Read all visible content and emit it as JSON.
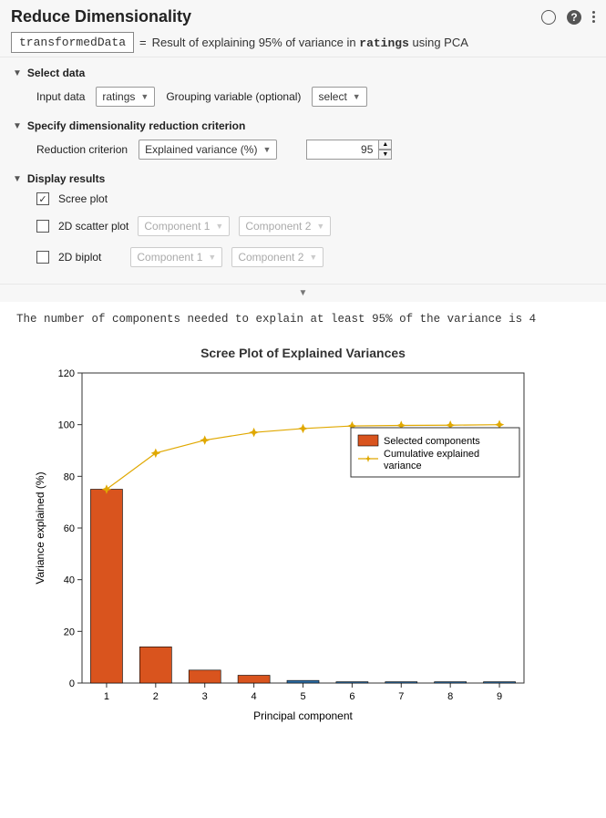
{
  "header": {
    "title": "Reduce Dimensionality",
    "var_name": "transformedData",
    "equals": "=",
    "result_text_pre": "Result of explaining 95% of variance in ",
    "result_text_mono": "ratings",
    "result_text_post": " using PCA"
  },
  "sections": {
    "select_data": {
      "title": "Select data",
      "input_label": "Input data",
      "input_value": "ratings",
      "grouping_label": "Grouping variable (optional)",
      "grouping_value": "select"
    },
    "criterion": {
      "title": "Specify dimensionality reduction criterion",
      "label": "Reduction criterion",
      "value": "Explained variance (%)",
      "number": "95"
    },
    "display": {
      "title": "Display results",
      "scree": "Scree plot",
      "scatter": "2D scatter plot",
      "biplot": "2D biplot",
      "comp1": "Component 1",
      "comp2": "Component 2"
    }
  },
  "output_line": "The number of components needed to explain at least 95% of the variance is 4",
  "chart": {
    "title": "Scree Plot of Explained Variances",
    "xlabel": "Principal component",
    "ylabel": "Variance explained (%)",
    "legend_sel": "Selected components",
    "legend_cum": "Cumulative explained variance"
  },
  "chart_data": {
    "type": "bar+line",
    "categories": [
      1,
      2,
      3,
      4,
      5,
      6,
      7,
      8,
      9
    ],
    "series": [
      {
        "name": "Selected components bar (%)",
        "values": [
          75,
          14,
          5,
          3,
          1,
          0.5,
          0.5,
          0.5,
          0.5
        ],
        "selected_until": 4
      },
      {
        "name": "Cumulative explained variance (%)",
        "values": [
          75,
          89,
          94,
          97,
          98.5,
          99.5,
          99.7,
          99.8,
          100
        ]
      }
    ],
    "title": "Scree Plot of Explained Variances",
    "xlabel": "Principal component",
    "ylabel": "Variance explained (%)",
    "ylim": [
      0,
      120
    ],
    "yticks": [
      0,
      20,
      40,
      60,
      80,
      100,
      120
    ],
    "colors": {
      "selected": "#d9541e",
      "unselected": "#2f6fa8",
      "line": "#e0a800"
    }
  }
}
